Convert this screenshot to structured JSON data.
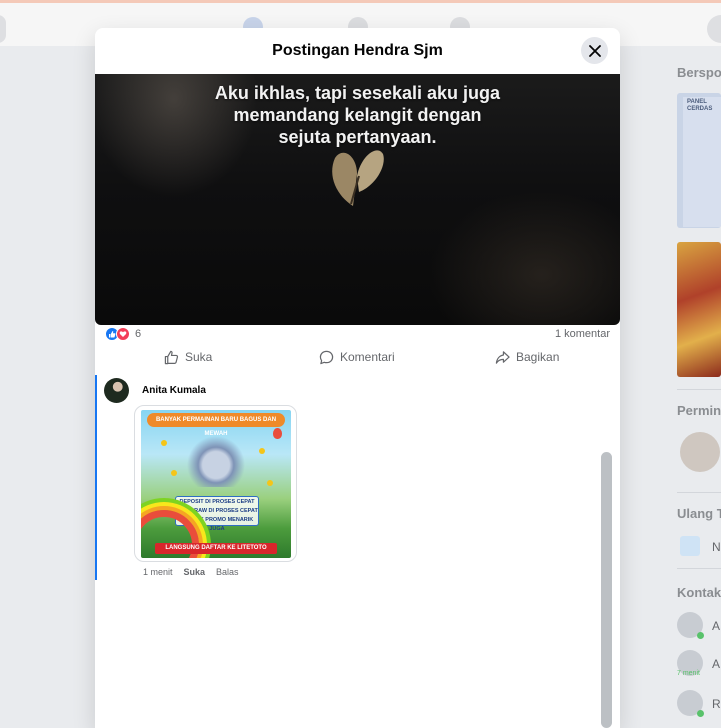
{
  "modal": {
    "title": "Postingan Hendra Sjm",
    "close_label": "close-icon"
  },
  "post": {
    "media_caption": "Aku ikhlas, tapi sesekali aku juga\nmemandang kelangit dengan\nsejuta pertanyaan.",
    "reaction_count": "6",
    "comment_count": "1 komentar",
    "reactions": [
      "like-icon",
      "love-icon"
    ]
  },
  "actions": {
    "like": "Suka",
    "comment": "Komentari",
    "share": "Bagikan"
  },
  "comment": {
    "author": "Anita Kumala",
    "image_text_top": "BANYAK PERMAINAN BARU BAGUS DAN MEWAH",
    "image_text_middle": [
      "DEPOSIT DI PROSES CEPAT",
      "WITHDRAW DI PROSES CEPAT",
      "BANYAK PROMO MENARIK JUGA"
    ],
    "image_text_bottom": "LANGSUNG DAFTAR KE LITETOTO",
    "time": "1 menit",
    "like": "Suka",
    "reply": "Balas"
  },
  "background": {
    "headings": [
      "Bersponsor",
      "Permintaan",
      "Ulang Tahun",
      "Kontak"
    ],
    "contact_letters": [
      "A",
      "A",
      "Ro"
    ],
    "birthday_letter": "N",
    "tiny_time": "7 menit",
    "ad_text": "PANEL CERDAS"
  },
  "colors": {
    "accent": "#1877f2",
    "love": "#f33e58",
    "text_secondary": "#65676b"
  }
}
